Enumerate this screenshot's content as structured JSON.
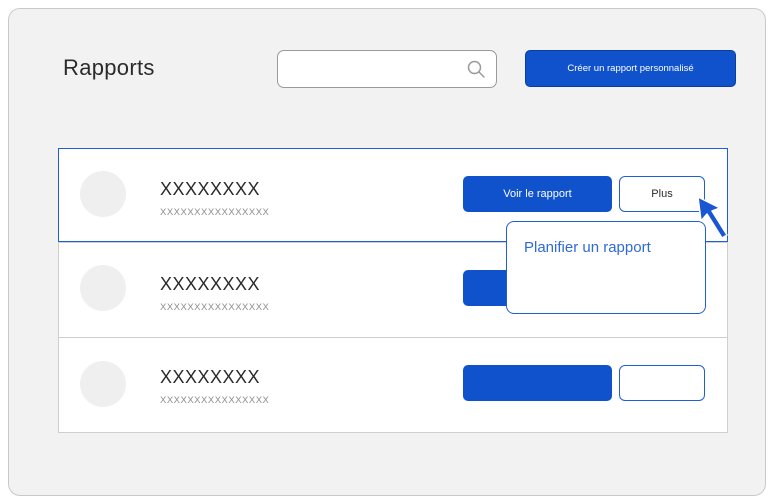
{
  "header": {
    "title": "Rapports",
    "search_value": "",
    "search_icon": "search-icon",
    "create_button_label": "Créer un rapport personnalisé"
  },
  "reports": [
    {
      "title": "XXXXXXXX",
      "subtitle": "XXXXXXXXXXXXXXXX",
      "view_label": "Voir le rapport",
      "more_label": "Plus",
      "selected": true
    },
    {
      "title": "XXXXXXXX",
      "subtitle": "XXXXXXXXXXXXXXXX",
      "view_label": "",
      "more_label": "",
      "selected": false
    },
    {
      "title": "XXXXXXXX",
      "subtitle": "XXXXXXXXXXXXXXXX",
      "view_label": "",
      "more_label": "",
      "selected": false
    }
  ],
  "more_menu": {
    "items": [
      "Planifier un rapport"
    ]
  },
  "colors": {
    "accent": "#0f52cc",
    "outline": "#1f5ed6",
    "menu_text": "#2f6ad8",
    "panel_background": "#f2f2f2"
  },
  "icons": {
    "cursor": "pointer-arrow-icon"
  }
}
